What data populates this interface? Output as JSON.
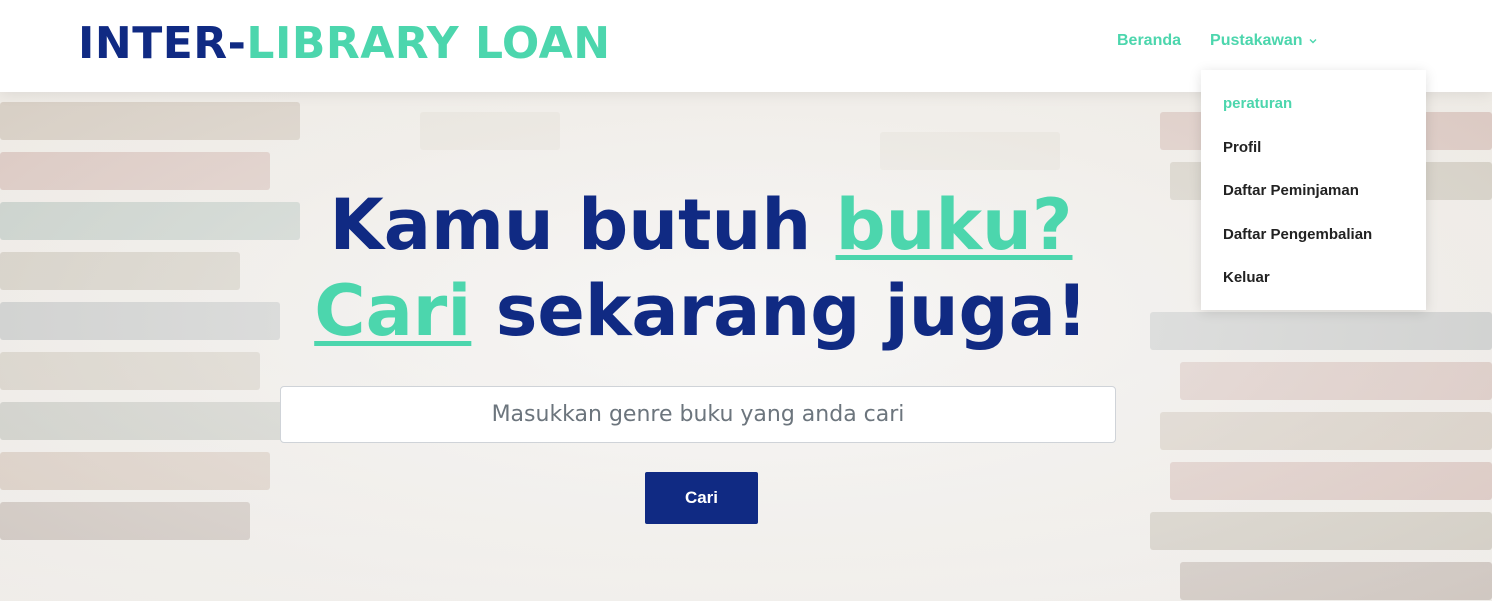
{
  "brand": {
    "part1": "INTER-",
    "part2": "LIBRARY LOAN"
  },
  "nav": {
    "home": "Beranda",
    "librarian": "Pustakawan",
    "librarian_icon": "chevron-down-icon"
  },
  "dropdown": {
    "items": [
      {
        "label": "peraturan",
        "active": true
      },
      {
        "label": "Profil"
      },
      {
        "label": "Daftar Peminjaman"
      },
      {
        "label": "Daftar Pengembalian"
      },
      {
        "label": "Keluar"
      }
    ]
  },
  "hero": {
    "line1_text": "Kamu butuh ",
    "line1_highlight": "buku?",
    "line2_highlight": "Cari",
    "line2_text": " sekarang juga!",
    "search_placeholder": "Masukkan genre buku yang anda cari",
    "search_button": "Cari"
  },
  "colors": {
    "primary": "#102a83",
    "accent": "#4cd6ad"
  }
}
